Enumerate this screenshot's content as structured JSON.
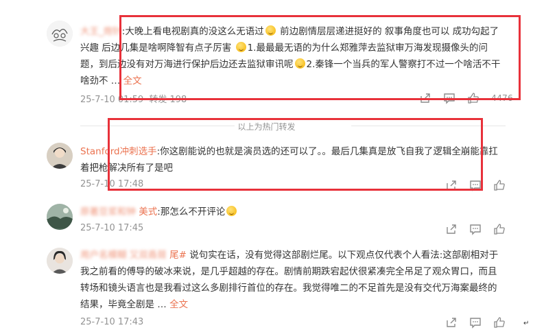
{
  "section_label": "以上为热门转发",
  "comments": [
    {
      "username": "大王_炮针",
      "separator": ":",
      "segments": [
        "大晚上看电视剧真的没这么无语过",
        " 前边剧情层层递进挺好的 叙事角度也可以 成功勾起了兴趣 后边几集是啥啊降智有点子厉害 ",
        "1.最最最无语的为什么郑雅萍去监狱审万海发现摄像头的问题，到后边没有对万海进行保护后边还去监狱审讯呢",
        "2.秦锋一个当兵的军人警察打不过一个啥活不干啥劲不 … "
      ],
      "fulltext": "全文",
      "time": "25-7-10 01:59",
      "repost": "转发 198",
      "likes": "4476"
    },
    {
      "username": "Stanford冲刺选手",
      "separator": ":",
      "text": "你这剧能说的也就是演员选的还可以了。。最后几集真是放飞自我了逻辑全崩能靠扛着把枪解决所有了是吧",
      "time": "25-7-10 17:48"
    },
    {
      "username_visible": "原著豆浆和钟",
      "username_suffix": "美式",
      "separator": ":",
      "text": "那怎么不开评论",
      "time": "25-7-10 17:45"
    },
    {
      "username_blur_1": "用户名模糊",
      "username_blur_2": "又双叒叕",
      "username_suffix": "尾#",
      "text": " 说句实在话，没有觉得这部剧烂尾。以下观点仅代表个人看法:这部剧相对于我之前看的傅导的破冰来说，是几乎超越的存在。剧情前期跌宕起伏很紧凑完全吊足了观众胃口，而且转场和镜头语言也是我看过这么多剧排行首位的存在。我觉得唯二的不足首先是没有交代万海案最终的结果，毕竟全剧是 … ",
      "fulltext": "全文",
      "time": "25-7-10 17:43"
    }
  ],
  "icons": {
    "share": "share-icon",
    "comment": "comment-icon",
    "like": "like-icon"
  },
  "colors": {
    "link": "#eb7350",
    "meta": "#939393",
    "highlight_box": "#e8313a"
  },
  "cursor_glyph": "↵"
}
